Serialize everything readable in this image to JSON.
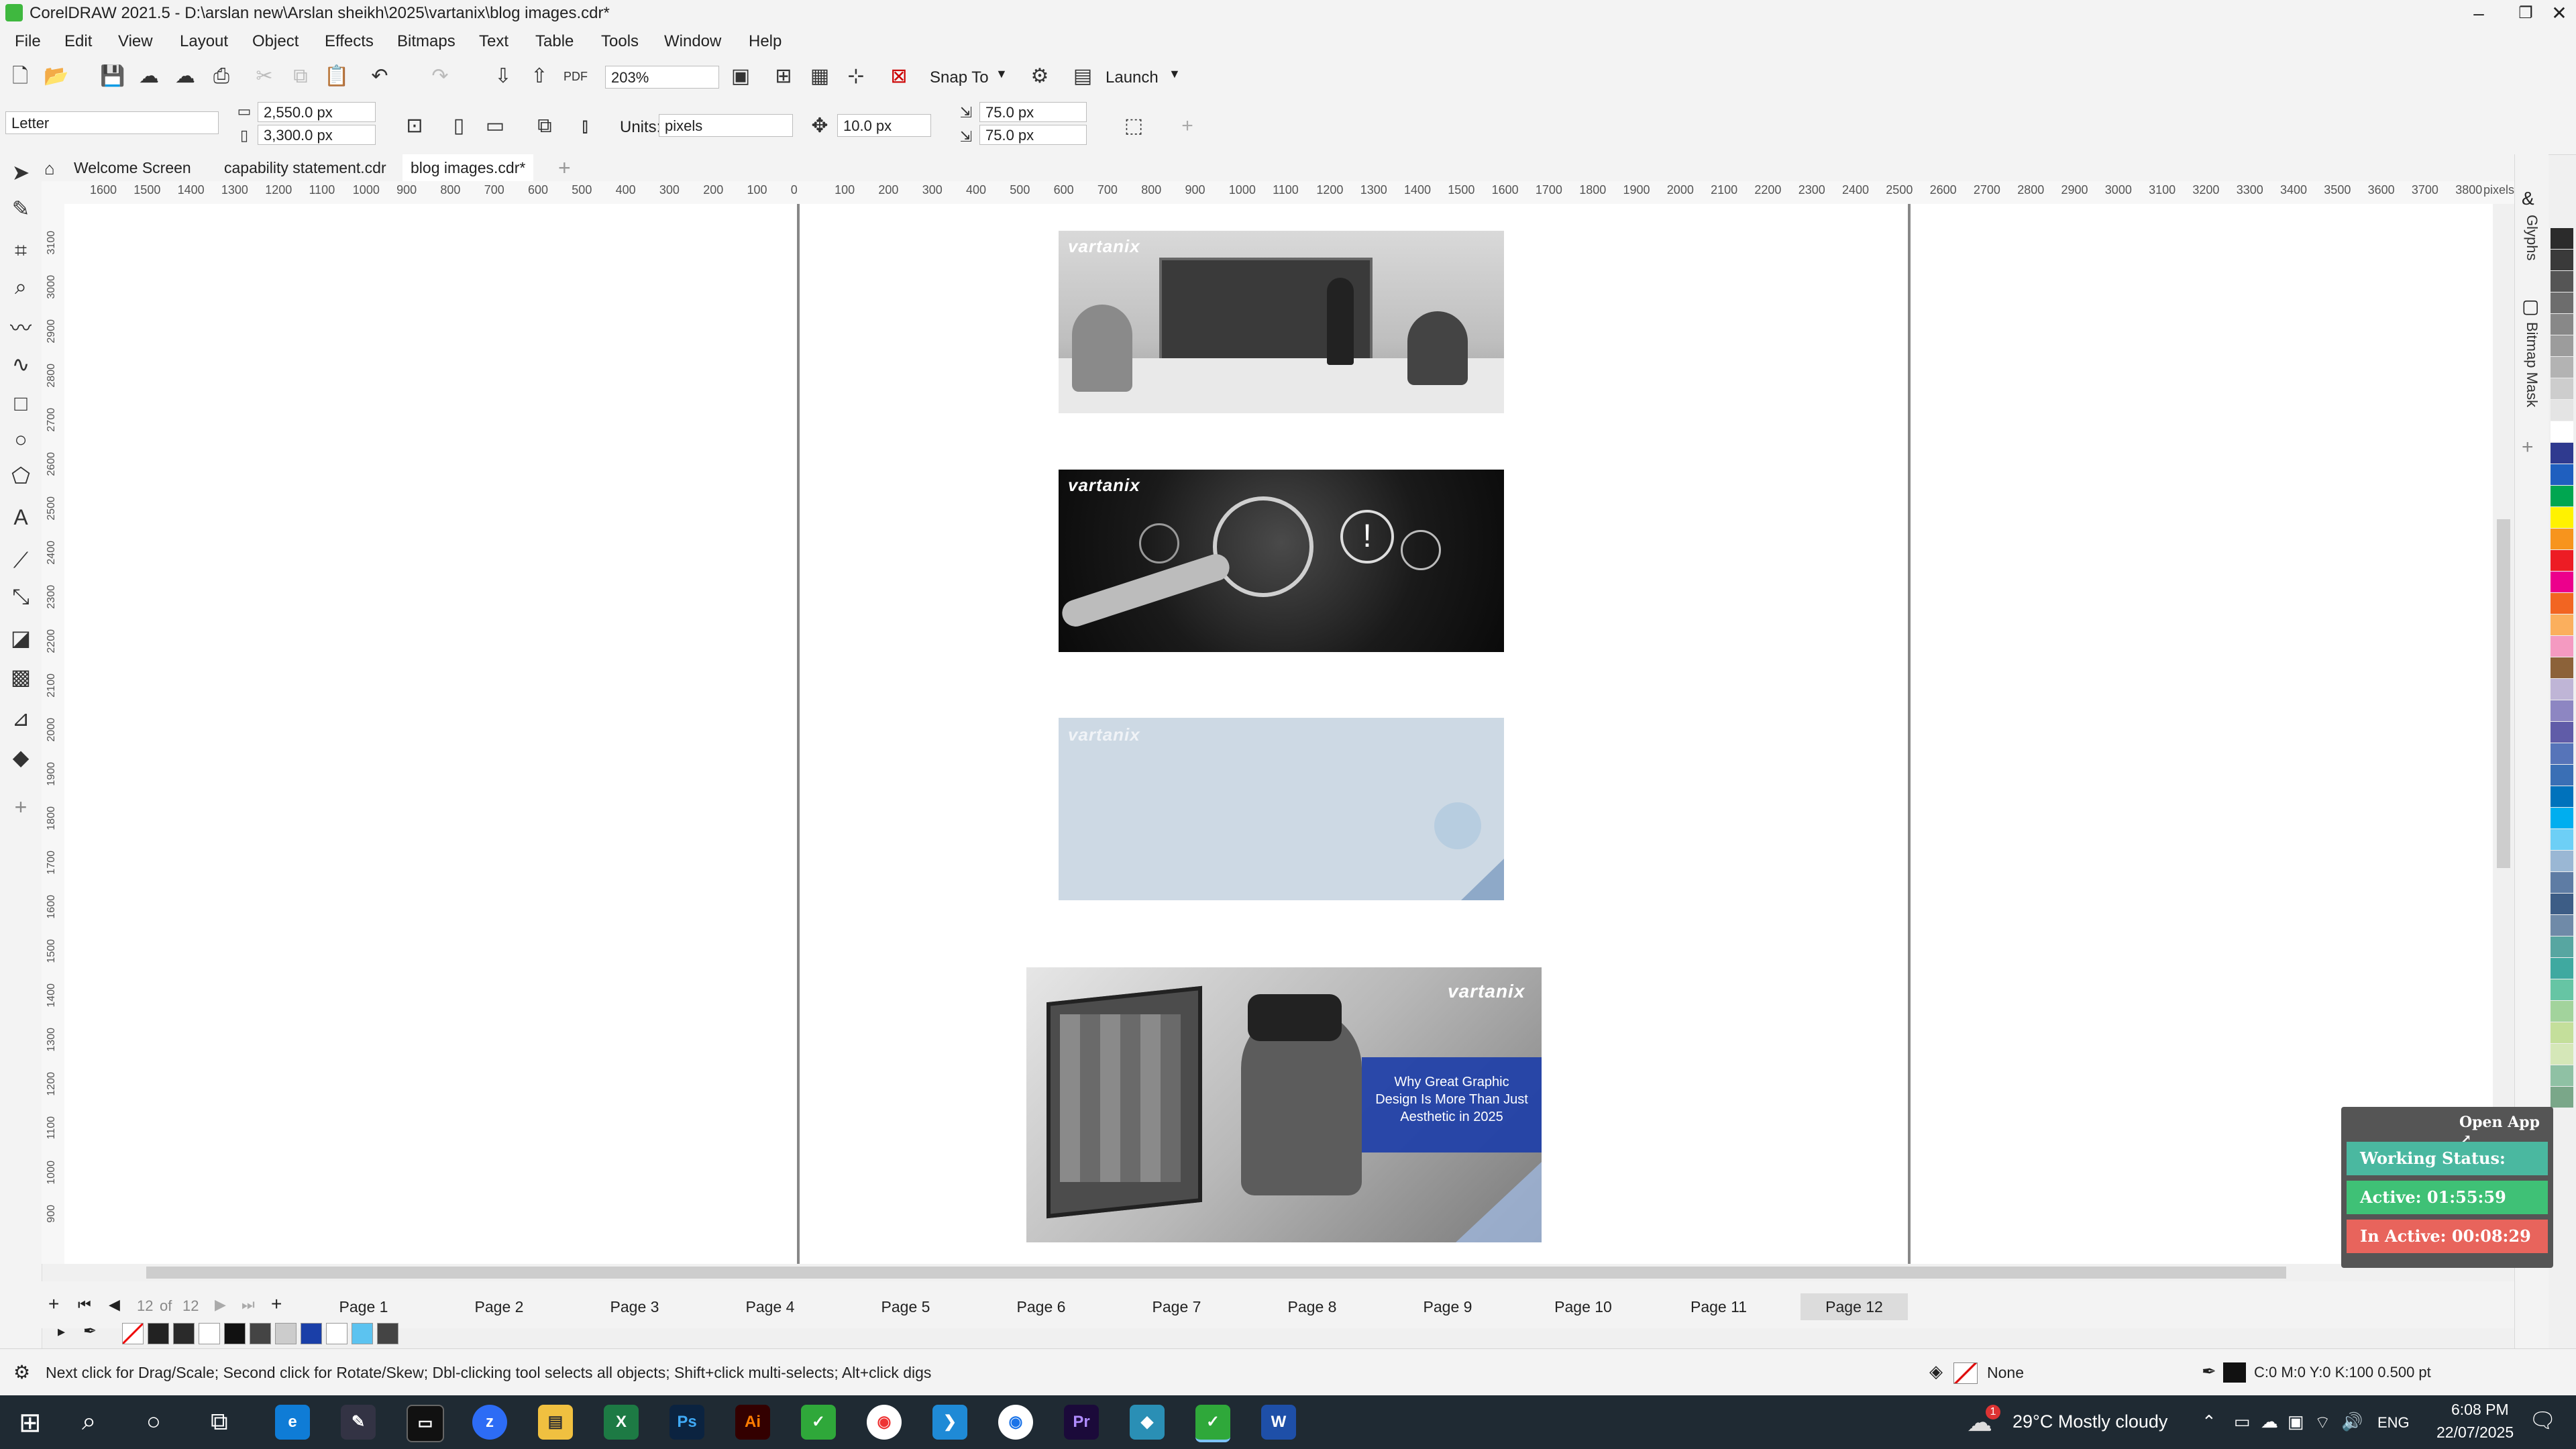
{
  "window": {
    "title": "CorelDRAW 2021.5 - D:\\arslan new\\Arslan sheikh\\2025\\vartanix\\blog images.cdr*",
    "minimize": "–",
    "restore": "❐",
    "close": "✕"
  },
  "menu": [
    "File",
    "Edit",
    "View",
    "Layout",
    "Object",
    "Effects",
    "Bitmaps",
    "Text",
    "Table",
    "Tools",
    "Window",
    "Help"
  ],
  "toolbar": {
    "zoom": "203%",
    "snap_to": "Snap To",
    "launch": "Launch",
    "pdf": "PDF"
  },
  "propertybar": {
    "page_size": "Letter",
    "width": "2,550.0 px",
    "height": "3,300.0 px",
    "units_label": "Units:",
    "units": "pixels",
    "nudge": "10.0 px",
    "dup_x": "75.0 px",
    "dup_y": "75.0 px"
  },
  "doc_tabs": [
    "Welcome Screen",
    "capability statement.cdr",
    "blog images.cdr*"
  ],
  "ruler": {
    "labels": [
      "1600",
      "1500",
      "1400",
      "1300",
      "1200",
      "1100",
      "1000",
      "900",
      "800",
      "700",
      "600",
      "500",
      "400",
      "300",
      "200",
      "100",
      "0",
      "100",
      "200",
      "300",
      "400",
      "500",
      "600",
      "700",
      "800",
      "900",
      "1000",
      "1100",
      "1200",
      "1300",
      "1400",
      "1500",
      "1600",
      "1700",
      "1800",
      "1900",
      "2000",
      "2100",
      "2200",
      "2300",
      "2400",
      "2500",
      "2600",
      "2700",
      "2800",
      "2900",
      "3000",
      "3100",
      "3200",
      "3300",
      "3400",
      "3500",
      "3600",
      "3700",
      "3800"
    ],
    "unit": "pixels",
    "vlabels": [
      "3100",
      "3000",
      "2900",
      "2800",
      "2700",
      "2600",
      "2500",
      "2400",
      "2300",
      "2200",
      "2100",
      "2000",
      "1900",
      "1800",
      "1700",
      "1600",
      "1500",
      "1400",
      "1300",
      "1200",
      "1100",
      "1000",
      "900"
    ]
  },
  "canvas": {
    "logo": "vartanix",
    "card4_text": "Why Great Graphic Design Is More Than Just Aesthetic in 2025"
  },
  "pages": {
    "current": "12",
    "of": "of",
    "total": "12",
    "tabs": [
      "Page 1",
      "Page 2",
      "Page 3",
      "Page 4",
      "Page 5",
      "Page 6",
      "Page 7",
      "Page 8",
      "Page 9",
      "Page 10",
      "Page 11",
      "Page 12"
    ]
  },
  "dockers": [
    "Glyphs",
    "Bitmap Mask"
  ],
  "palette_colors": [
    "#2b2b2b",
    "#3a3a3a",
    "#555",
    "#6d6d6d",
    "#888",
    "#9c9c9c",
    "#b3b3b3",
    "#cdcdcd",
    "#e4e4e4",
    "#fff",
    "#2f3a8f",
    "#1f5fbf",
    "#00a650",
    "#fff200",
    "#f7941d",
    "#ed1c24",
    "#ec008c",
    "#f26522",
    "#fbaf5d",
    "#f49ac1",
    "#8c6239",
    "#bfb5d6",
    "#8d86c2",
    "#605ca8",
    "#5674b9",
    "#3a6fb5",
    "#0072bc",
    "#00aeef",
    "#6dcff6",
    "#9ab7d4",
    "#5e7ca4",
    "#3d5d86",
    "#6f8aa8",
    "#57a6a1",
    "#3fa9a0",
    "#66c5a4",
    "#a2d39c",
    "#c4df9b",
    "#d5e7b8",
    "#8fc1a4",
    "#7aa789"
  ],
  "widget": {
    "open_app": "Open App ↗",
    "working_status": "Working Status: Active",
    "active": "Active: 01:55:59",
    "inactive": "In Active: 00:08:29"
  },
  "status": {
    "hint": "Next click for Drag/Scale; Second click for Rotate/Skew; Dbl-clicking tool selects all objects; Shift+click multi-selects; Alt+click digs",
    "fill": "None",
    "outline": "C:0 M:0 Y:0 K:100  0.500 pt"
  },
  "taskbar": {
    "weather": "29°C  Mostly cloudy",
    "lang": "ENG",
    "time": "6:08 PM",
    "date": "22/07/2025",
    "weather_badge": "1"
  },
  "colors": {
    "accent": "#2b7bd6",
    "widget_status": "#4ab8a0",
    "widget_active": "#3fc176",
    "widget_inactive": "#e8645c",
    "card_blue": "#1e3fa8"
  }
}
